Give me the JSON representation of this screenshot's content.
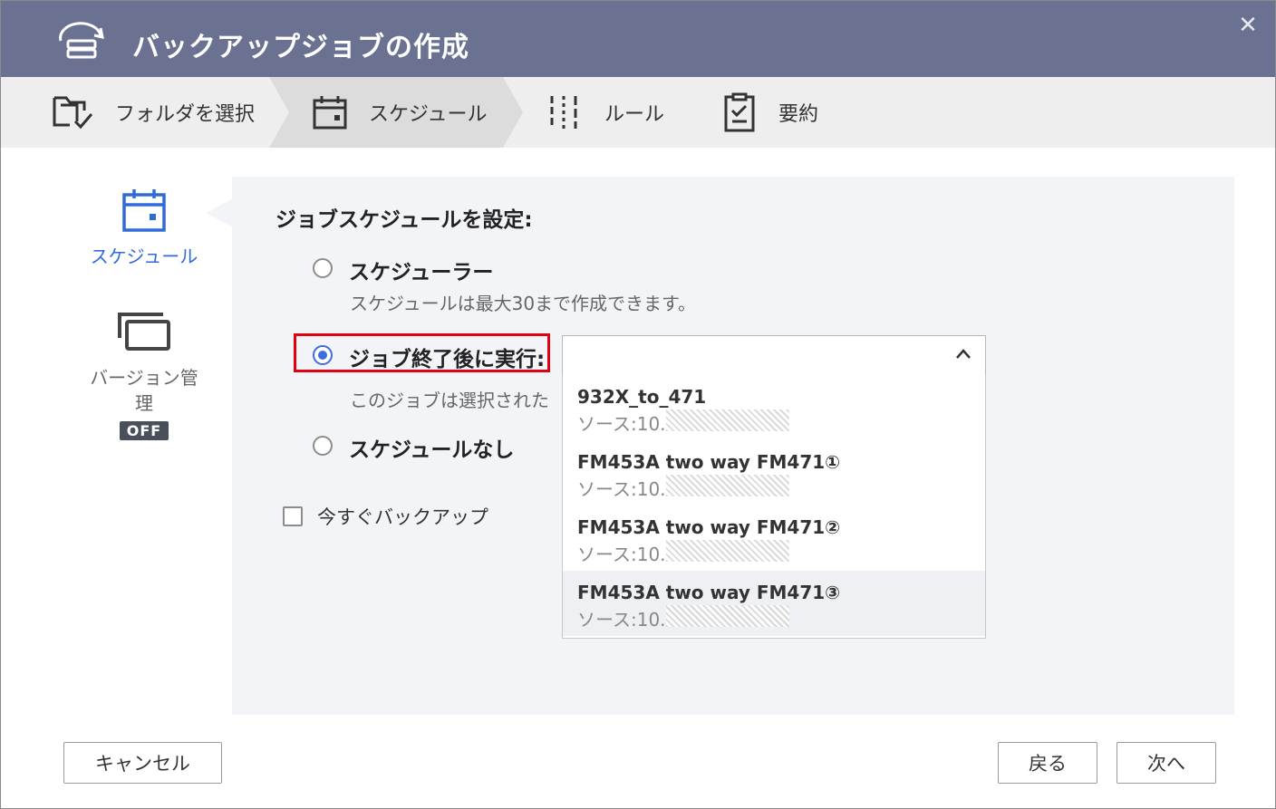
{
  "window": {
    "title": "バックアップジョブの作成",
    "close_symbol": "✕"
  },
  "steps": [
    {
      "label": "フォルダを選択",
      "icon": "folder-check-icon"
    },
    {
      "label": "スケジュール",
      "icon": "calendar-icon",
      "active": true
    },
    {
      "label": "ルール",
      "icon": "sliders-icon"
    },
    {
      "label": "要約",
      "icon": "clipboard-icon"
    }
  ],
  "sidebar": {
    "items": [
      {
        "label": "スケジュール",
        "icon": "calendar-icon",
        "active": true
      },
      {
        "label": "バージョン管理",
        "icon": "versions-icon",
        "badge": "OFF"
      }
    ]
  },
  "schedule": {
    "heading": "ジョブスケジュールを設定:",
    "options": [
      {
        "label": "スケジューラー",
        "description": "スケジュールは最大30まで作成できます。",
        "checked": false
      },
      {
        "label": "ジョブ終了後に実行:",
        "description": "このジョブは選択された",
        "checked": true
      },
      {
        "label": "スケジュールなし",
        "checked": false
      }
    ],
    "backup_now_label": "今すぐバックアップ",
    "backup_now_checked": false
  },
  "dropdown": {
    "selected_value": "",
    "expanded": true,
    "items": [
      {
        "name": "932X_to_471",
        "source": "ソース:10."
      },
      {
        "name": "FM453A two way FM471①",
        "source": "ソース:10."
      },
      {
        "name": "FM453A two way FM471②",
        "source": "ソース:10."
      },
      {
        "name": "FM453A two way FM471③",
        "source": "ソース:10.",
        "hovered": true
      }
    ]
  },
  "footer": {
    "cancel_label": "キャンセル",
    "back_label": "戻る",
    "next_label": "次へ"
  },
  "colors": {
    "title_bar": "#6b7190",
    "accent_blue": "#3d6be0",
    "highlight_red": "#e3000f",
    "steps_bg": "#eeeeee",
    "active_step_bg": "#dcdcdc",
    "panel_bg": "#f2f4f8"
  }
}
